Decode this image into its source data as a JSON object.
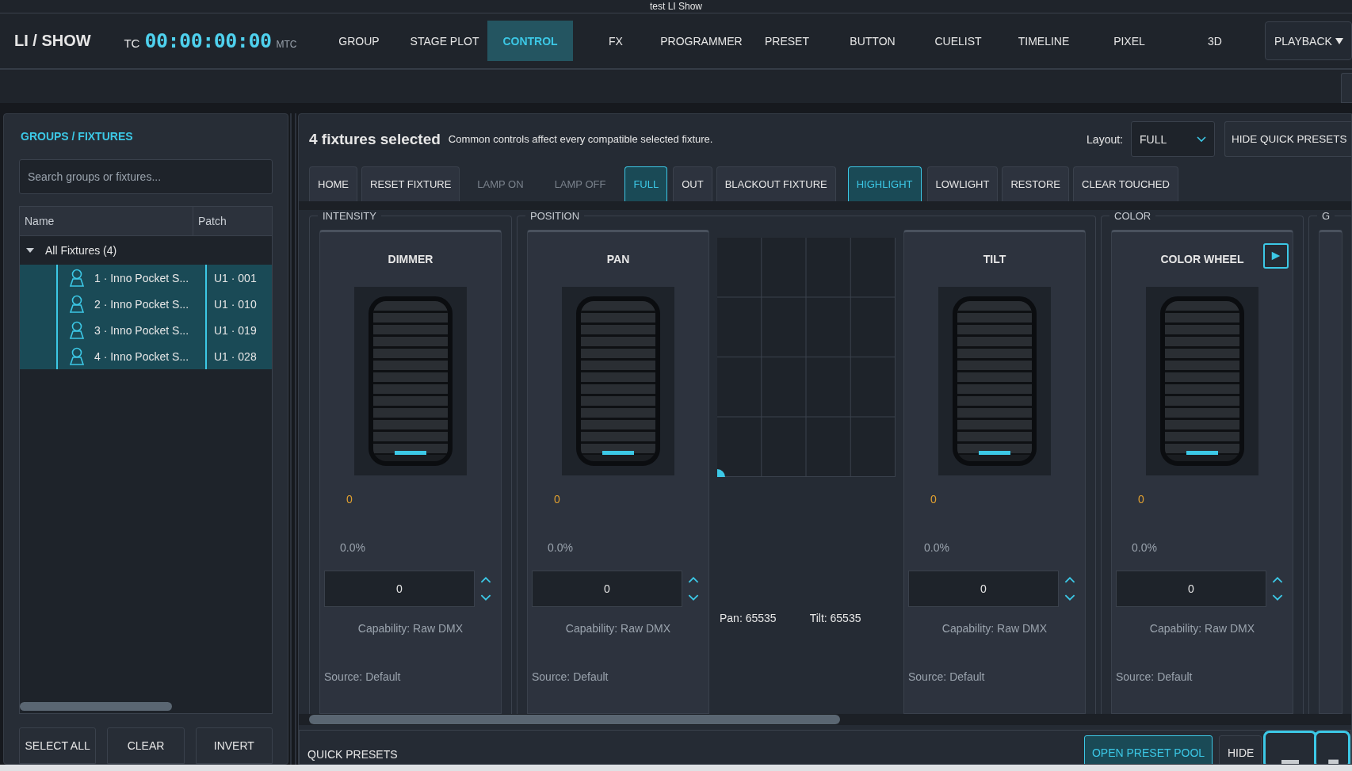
{
  "window": {
    "title": "test LI Show"
  },
  "app": {
    "logo": "LI / SHOW",
    "tc_label": "TC",
    "timecode": "00:00:00:00",
    "mtc_label": "MTC"
  },
  "nav_tabs": [
    {
      "label": "GROUP",
      "selected": false
    },
    {
      "label": "STAGE PLOT",
      "selected": false
    },
    {
      "label": "CONTROL",
      "selected": true
    },
    {
      "label": "FX",
      "selected": false
    },
    {
      "label": "PROGRAMMER",
      "selected": false
    },
    {
      "label": "PRESET",
      "selected": false
    },
    {
      "label": "BUTTON",
      "selected": false
    },
    {
      "label": "CUELIST",
      "selected": false
    },
    {
      "label": "TIMELINE",
      "selected": false
    },
    {
      "label": "PIXEL",
      "selected": false
    },
    {
      "label": "3D",
      "selected": false
    }
  ],
  "playback_menu": {
    "label": "PLAYBACK"
  },
  "sidebar": {
    "title": "GROUPS / FIXTURES",
    "search": {
      "placeholder": "Search groups or fixtures..."
    },
    "columns": [
      "Name",
      "Patch"
    ],
    "tree": [
      {
        "label": "All Fixtures (4)",
        "expanded": true,
        "children": [
          {
            "name": "1 · Inno Pocket S...",
            "patch": "U1 · 001",
            "selected": true
          },
          {
            "name": "2 · Inno Pocket S...",
            "patch": "U1 · 010",
            "selected": true
          },
          {
            "name": "3 · Inno Pocket S...",
            "patch": "U1 · 019",
            "selected": true
          },
          {
            "name": "4 · Inno Pocket S...",
            "patch": "U1 · 028",
            "selected": true
          }
        ]
      }
    ],
    "buttons": [
      "SELECT ALL",
      "CLEAR",
      "INVERT"
    ]
  },
  "control": {
    "heading": "4 fixtures selected",
    "hint": "Common controls affect every compatible selected fixture.",
    "layout_label": "Layout:",
    "layout_value": "FULL",
    "hide_presets_button": "HIDE QUICK PRESETS",
    "actions": [
      {
        "label": "HOME",
        "active": false,
        "disabled": false
      },
      {
        "label": "RESET FIXTURE",
        "active": false,
        "disabled": false
      },
      {
        "label": "LAMP ON",
        "active": false,
        "disabled": true
      },
      {
        "label": "LAMP OFF",
        "active": false,
        "disabled": true
      },
      {
        "label": "FULL",
        "active": true,
        "disabled": false
      },
      {
        "label": "OUT",
        "active": false,
        "disabled": false
      },
      {
        "label": "BLACKOUT FIXTURE",
        "active": false,
        "disabled": false
      },
      {
        "label": "HIGHLIGHT",
        "active": true,
        "disabled": false
      },
      {
        "label": "LOWLIGHT",
        "active": false,
        "disabled": false
      },
      {
        "label": "RESTORE",
        "active": false,
        "disabled": false
      },
      {
        "label": "CLEAR TOUCHED",
        "active": false,
        "disabled": false
      }
    ],
    "groups": [
      {
        "title": "INTENSITY",
        "items": [
          {
            "kind": "fader",
            "name": "DIMMER",
            "level": 0,
            "value": "0",
            "percent": "0.0%",
            "input": "0",
            "capability": "Capability: Raw DMX",
            "source": "Source: Default",
            "has_play": false
          }
        ]
      },
      {
        "title": "POSITION",
        "items": [
          {
            "kind": "fader",
            "name": "PAN",
            "level": 0,
            "value": "0",
            "percent": "0.0%",
            "input": "0",
            "capability": "Capability: Raw DMX",
            "source": "Source: Default",
            "has_play": false
          },
          {
            "kind": "xy",
            "pan_text": "Pan: 65535",
            "tilt_text": "Tilt: 65535"
          },
          {
            "kind": "fader",
            "name": "TILT",
            "level": 0,
            "value": "0",
            "percent": "0.0%",
            "input": "0",
            "capability": "Capability: Raw DMX",
            "source": "Source: Default",
            "has_play": false
          }
        ]
      },
      {
        "title": "COLOR",
        "items": [
          {
            "kind": "fader",
            "name": "COLOR WHEEL",
            "level": 0,
            "value": "0",
            "percent": "0.0%",
            "input": "0",
            "capability": "Capability: Raw DMX",
            "source": "Source: Default",
            "has_play": true
          }
        ]
      },
      {
        "title": "G"
      }
    ]
  },
  "quick_presets": {
    "title": "QUICK PRESETS",
    "open_button": "OPEN PRESET POOL",
    "hide_button": "HIDE"
  }
}
